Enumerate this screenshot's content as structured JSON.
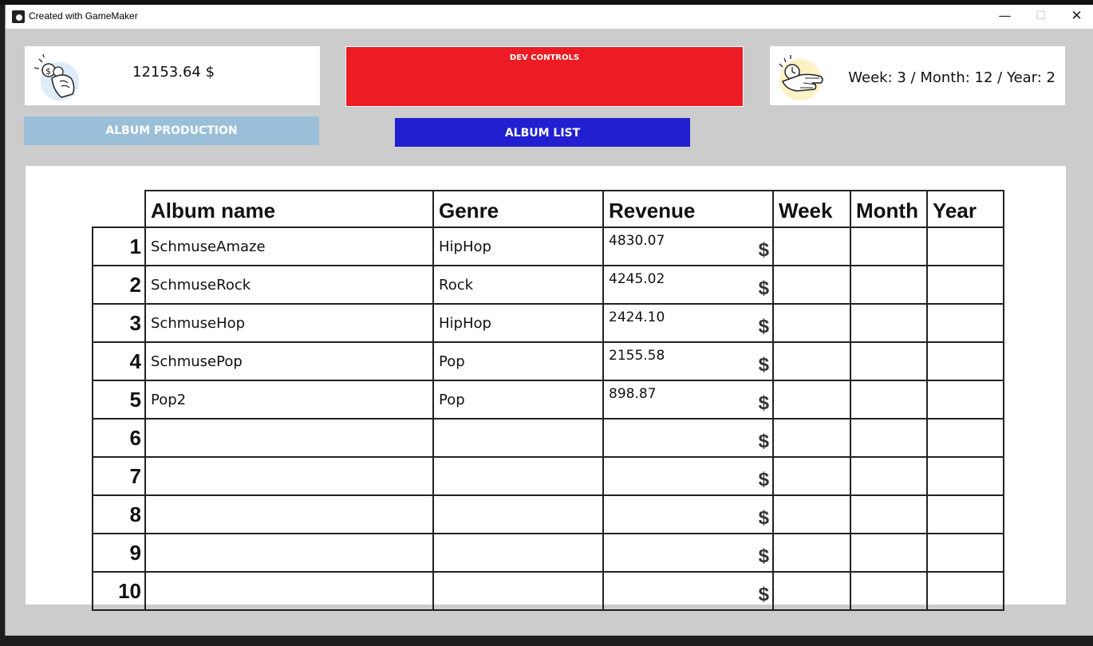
{
  "window": {
    "title": "Created with GameMaker",
    "minimize": "—",
    "maximize": "☐",
    "close": "✕"
  },
  "stats": {
    "money": "12153.64 $",
    "dev_controls_label": "DEV CONTROLS",
    "date": "Week: 3 / Month: 12 / Year: 2"
  },
  "buttons": {
    "album_production": "ALBUM PRODUCTION",
    "album_list": "ALBUM LIST"
  },
  "table": {
    "headers": [
      "Album name",
      "Genre",
      "Revenue",
      "Week",
      "Month",
      "Year"
    ],
    "currency_symbol": "$",
    "rows": [
      {
        "num": "1",
        "name": "SchmuseAmaze",
        "genre": "HipHop",
        "revenue": "4830.07",
        "week": "",
        "month": "",
        "year": ""
      },
      {
        "num": "2",
        "name": "SchmuseRock",
        "genre": "Rock",
        "revenue": "4245.02",
        "week": "",
        "month": "",
        "year": ""
      },
      {
        "num": "3",
        "name": "SchmuseHop",
        "genre": "HipHop",
        "revenue": "2424.10",
        "week": "",
        "month": "",
        "year": ""
      },
      {
        "num": "4",
        "name": "SchmusePop",
        "genre": "Pop",
        "revenue": "2155.58",
        "week": "",
        "month": "",
        "year": ""
      },
      {
        "num": "5",
        "name": "Pop2",
        "genre": "Pop",
        "revenue": "898.87",
        "week": "",
        "month": "",
        "year": ""
      },
      {
        "num": "6",
        "name": "",
        "genre": "",
        "revenue": "",
        "week": "",
        "month": "",
        "year": ""
      },
      {
        "num": "7",
        "name": "",
        "genre": "",
        "revenue": "",
        "week": "",
        "month": "",
        "year": ""
      },
      {
        "num": "8",
        "name": "",
        "genre": "",
        "revenue": "",
        "week": "",
        "month": "",
        "year": ""
      },
      {
        "num": "9",
        "name": "",
        "genre": "",
        "revenue": "",
        "week": "",
        "month": "",
        "year": ""
      },
      {
        "num": "10",
        "name": "",
        "genre": "",
        "revenue": "",
        "week": "",
        "month": "",
        "year": ""
      }
    ]
  },
  "colors": {
    "dev_controls": "#ed1c24",
    "album_production": "#9bbfd8",
    "album_list": "#2020d0",
    "background": "#cccccc"
  },
  "icons": {
    "money": "hand-holding-coin-icon",
    "date": "hand-holding-clock-icon",
    "app": "gamemaker-icon"
  }
}
